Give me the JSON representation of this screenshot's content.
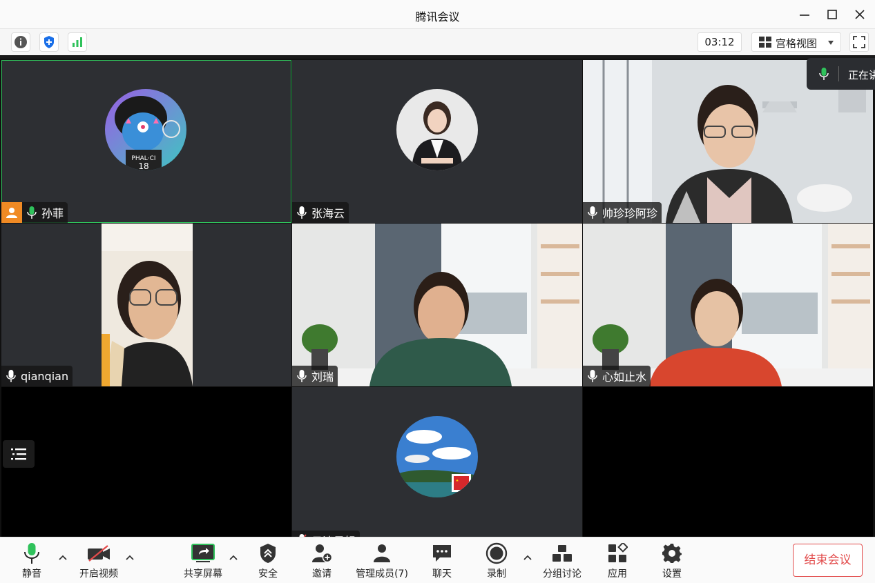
{
  "window": {
    "title": "腾讯会议"
  },
  "infobar": {
    "timer": "03:12",
    "view_mode": "宫格视图"
  },
  "speaking": {
    "label": "正在讲话"
  },
  "participants": [
    {
      "name": "孙菲",
      "role": "host"
    },
    {
      "name": "张海云"
    },
    {
      "name": "帅珍珍阿珍"
    },
    {
      "name": "qianqian"
    },
    {
      "name": "刘瑞"
    },
    {
      "name": "心如止水"
    },
    {
      "name": "云淡风轻"
    }
  ],
  "toolbar": {
    "mute": "静音",
    "video": "开启视频",
    "share": "共享屏幕",
    "security": "安全",
    "invite": "邀请",
    "members": "管理成员(7)",
    "chat": "聊天",
    "record": "录制",
    "breakout": "分组讨论",
    "apps": "应用",
    "settings": "设置",
    "end": "结束会议"
  },
  "colors": {
    "accent_green": "#2fc25b",
    "end_red": "#e24b4b",
    "host_orange": "#f08a24"
  }
}
